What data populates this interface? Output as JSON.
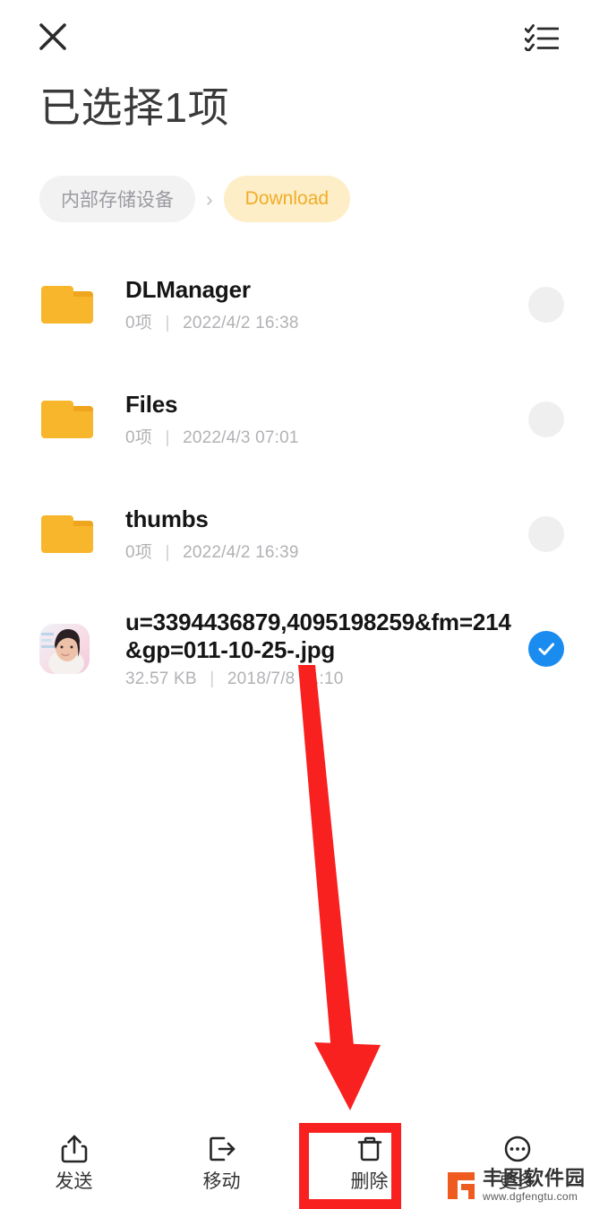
{
  "topbar": {
    "close_icon": "close-icon",
    "close_label": "关闭",
    "select_all_icon": "select-all-checklist-icon",
    "select_all_label": "全选"
  },
  "header": {
    "title": "已选择1项"
  },
  "breadcrumb": {
    "separator": "›",
    "items": [
      {
        "label": "内部存储设备",
        "state": "inactive"
      },
      {
        "label": "Download",
        "state": "active"
      }
    ]
  },
  "file_list": {
    "rows": [
      {
        "name": "DLManager",
        "icon": "folder-icon",
        "count": "0项",
        "separator": "|",
        "date": "2022/4/2 16:38",
        "selected": false
      },
      {
        "name": "Files",
        "icon": "folder-icon",
        "count": "0项",
        "separator": "|",
        "date": "2022/4/3 07:01",
        "selected": false
      },
      {
        "name": "thumbs",
        "icon": "folder-icon",
        "count": "0项",
        "separator": "|",
        "date": "2022/4/2 16:39",
        "selected": false
      },
      {
        "name": "u=3394436879,4095198259&fm=214&gp=011-10-25-.jpg",
        "icon": "image-thumbnail",
        "count": "32.57 KB",
        "separator": "|",
        "date": "2018/7/8 01:10",
        "selected": true
      }
    ]
  },
  "toolbar": {
    "items": [
      {
        "label": "发送",
        "icon": "share-upload-icon",
        "highlighted": false
      },
      {
        "label": "移动",
        "icon": "move-arrow-out-icon",
        "highlighted": false
      },
      {
        "label": "删除",
        "icon": "trash-can-icon",
        "highlighted": true
      },
      {
        "label": "更多",
        "icon": "more-ellipsis-circle-icon",
        "highlighted": false
      }
    ]
  },
  "annotation": {
    "arrow_color": "#f92020",
    "box_color": "#f92020",
    "target_label": "删除"
  },
  "watermark": {
    "name": "丰图软件园",
    "url": "www.dgfengtu.com",
    "logo_color": "#ef5a1e"
  },
  "colors": {
    "accent_blue": "#1a8cf0",
    "folder_orange": "#f8b62c",
    "crumb_active_bg": "#fdeec8",
    "crumb_active_text": "#f0ad28",
    "annotation_red": "#f92020"
  }
}
